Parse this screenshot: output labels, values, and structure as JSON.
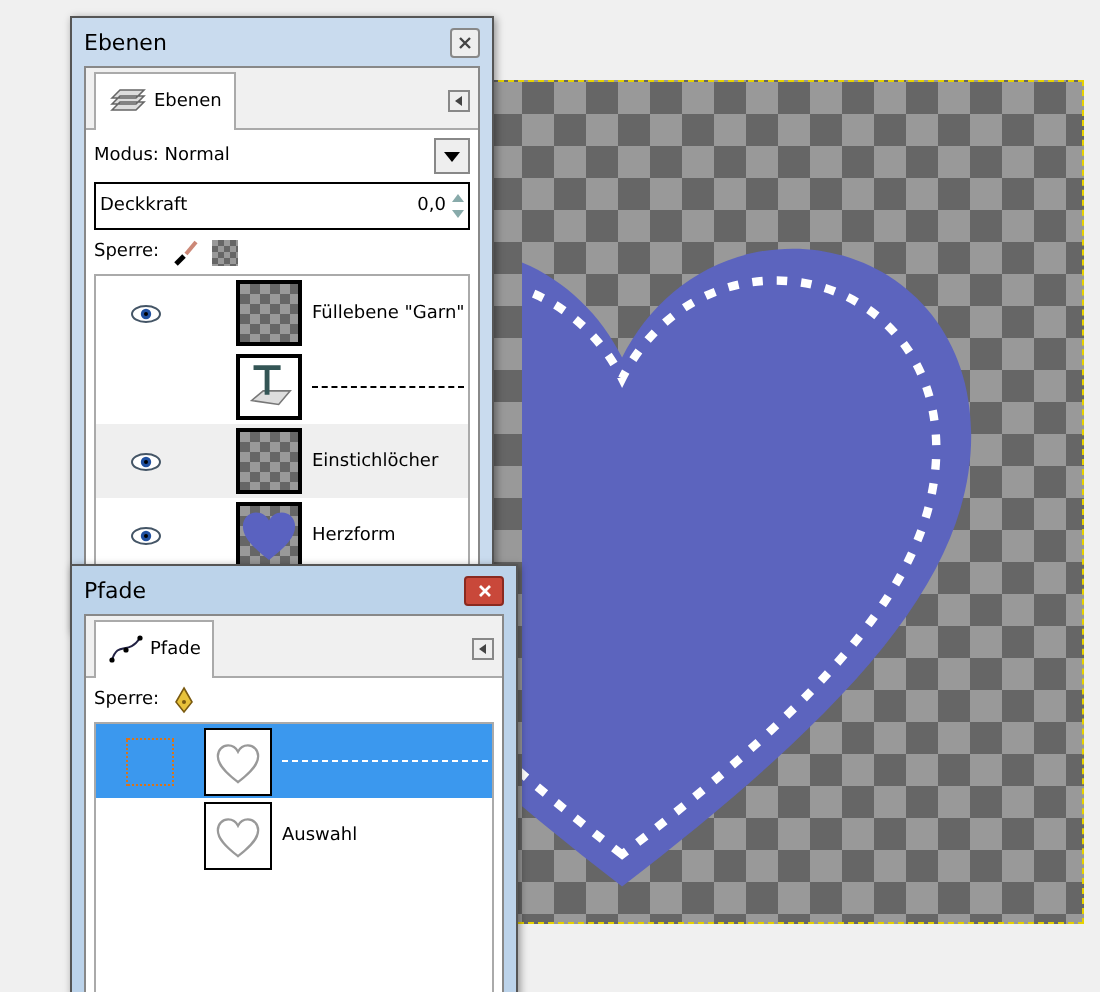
{
  "layers_window": {
    "title": "Ebenen",
    "tab": {
      "label": "Ebenen",
      "selected": true
    },
    "mode": {
      "label": "Modus:",
      "value": "Normal"
    },
    "opacity": {
      "label": "Deckkraft",
      "value": "0,0"
    },
    "lock_label": "Sperre:",
    "layers": [
      {
        "name": "Füllebene \"Garn\"",
        "visible": true,
        "highlighted": false,
        "kind": "checker"
      },
      {
        "visible": false,
        "highlighted": false,
        "kind": "text"
      },
      {
        "name": "Einstichlöcher",
        "visible": true,
        "highlighted": true,
        "kind": "checker"
      },
      {
        "name": "Herzform",
        "visible": true,
        "highlighted": false,
        "kind": "heart"
      }
    ]
  },
  "paths_window": {
    "title": "Pfade",
    "tab": {
      "label": "Pfade",
      "selected": true
    },
    "lock_label": "Sperre:",
    "paths": [
      {
        "selected": true,
        "linked": true
      },
      {
        "name": "Auswahl",
        "selected": false,
        "linked": false
      }
    ]
  }
}
